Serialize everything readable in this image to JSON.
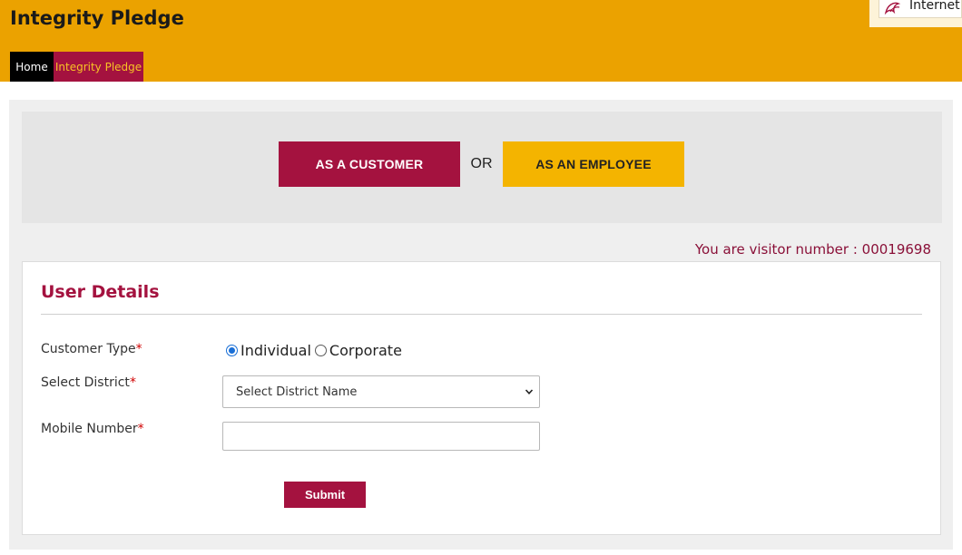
{
  "header": {
    "title": "Integrity Pledge",
    "badge_text": "Internet B",
    "badge_icon": "brand-logo-icon"
  },
  "nav": {
    "home": "Home",
    "integrity_pledge": "Integrity Pledge"
  },
  "choice": {
    "customer_label": "AS A CUSTOMER",
    "or_text": "OR",
    "employee_label": "AS AN EMPLOYEE"
  },
  "visitor_text": "You are visitor number : 00019698",
  "form": {
    "title": "User Details",
    "customer_type": {
      "label": "Customer Type",
      "required_mark": "*",
      "options": [
        "Individual",
        "Corporate"
      ],
      "selected": "Individual"
    },
    "district": {
      "label": "Select District",
      "required_mark": "*",
      "selected_value": "Select District Name"
    },
    "mobile": {
      "label": "Mobile Number",
      "required_mark": "*",
      "value": ""
    },
    "submit_label": "Submit"
  },
  "colors": {
    "header_bg": "#eba200",
    "brand_maroon": "#a4123f",
    "employee_yellow": "#f4b400",
    "nav_pledge_text": "#f7c325"
  }
}
